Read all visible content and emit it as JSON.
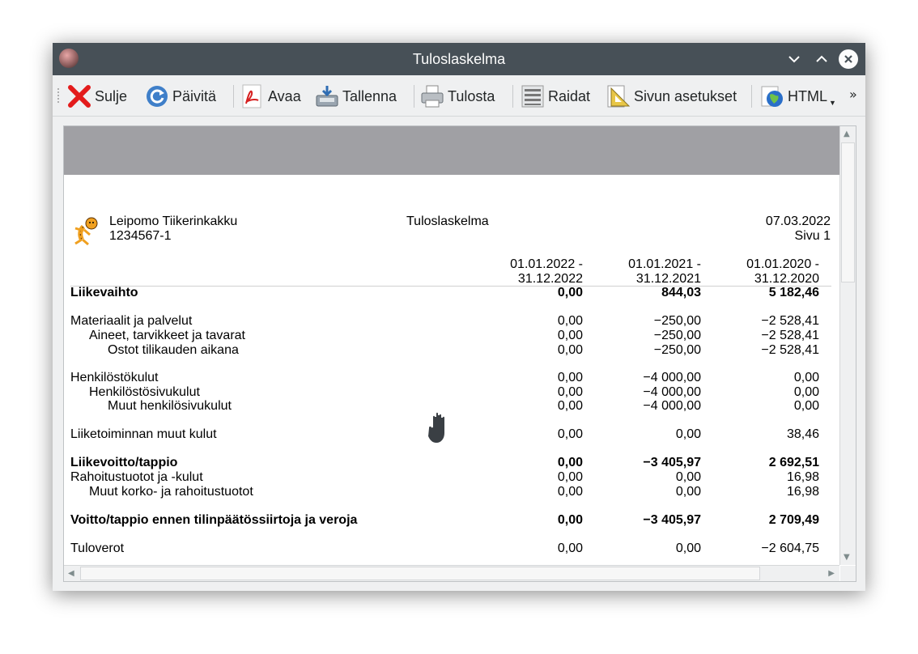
{
  "window": {
    "title": "Tuloslaskelma"
  },
  "toolbar": {
    "close_label": "Sulje",
    "refresh_label": "Päivitä",
    "open_label": "Avaa",
    "save_label": "Tallenna",
    "print_label": "Tulosta",
    "stripes_label": "Raidat",
    "page_setup_label": "Sivun asetukset",
    "html_label": "HTML",
    "overflow_label": "»"
  },
  "report": {
    "company": "Leipomo Tiikerinkakku",
    "company_id": "1234567-1",
    "title": "Tuloslaskelma",
    "date": "07.03.2022",
    "page": "Sivu 1",
    "columns": [
      {
        "line1": "01.01.2022 -",
        "line2": "31.12.2022"
      },
      {
        "line1": "01.01.2021 -",
        "line2": "31.12.2021"
      },
      {
        "line1": "01.01.2020 -",
        "line2": "31.12.2020"
      }
    ],
    "rows": [
      {
        "label": "Liikevaihto",
        "v1": "0,00",
        "v2": "844,03",
        "v3": "5 182,46"
      },
      {
        "label": "Materiaalit ja palvelut",
        "v1": "0,00",
        "v2": "−250,00",
        "v3": "−2 528,41"
      },
      {
        "label": "Aineet, tarvikkeet ja tavarat",
        "v1": "0,00",
        "v2": "−250,00",
        "v3": "−2 528,41"
      },
      {
        "label": "Ostot tilikauden aikana",
        "v1": "0,00",
        "v2": "−250,00",
        "v3": "−2 528,41"
      },
      {
        "label": "Henkilöstökulut",
        "v1": "0,00",
        "v2": "−4 000,00",
        "v3": "0,00"
      },
      {
        "label": "Henkilöstösivukulut",
        "v1": "0,00",
        "v2": "−4 000,00",
        "v3": "0,00"
      },
      {
        "label": "Muut henkilösivukulut",
        "v1": "0,00",
        "v2": "−4 000,00",
        "v3": "0,00"
      },
      {
        "label": "Liiketoiminnan muut kulut",
        "v1": "0,00",
        "v2": "0,00",
        "v3": "38,46"
      },
      {
        "label": "Liikevoitto/tappio",
        "v1": "0,00",
        "v2": "−3 405,97",
        "v3": "2 692,51"
      },
      {
        "label": "Rahoitustuotot ja -kulut",
        "v1": "0,00",
        "v2": "0,00",
        "v3": "16,98"
      },
      {
        "label": "Muut korko- ja rahoitustuotot",
        "v1": "0,00",
        "v2": "0,00",
        "v3": "16,98"
      },
      {
        "label": "Voitto/tappio ennen tilinpäätössiirtoja ja veroja",
        "v1": "0,00",
        "v2": "−3 405,97",
        "v3": "2 709,49"
      },
      {
        "label": "Tuloverot",
        "v1": "0,00",
        "v2": "0,00",
        "v3": "−2 604,75"
      }
    ]
  },
  "icons": {
    "app": "app-icon",
    "close": "red-x-icon",
    "refresh": "refresh-icon",
    "open": "pdf-icon",
    "save": "save-icon",
    "print": "printer-icon",
    "stripes": "stripes-icon",
    "page_setup": "page-setup-icon",
    "html": "globe-icon",
    "cursor": "grab-hand-cursor-icon",
    "logo": "tiger-logo-icon"
  }
}
